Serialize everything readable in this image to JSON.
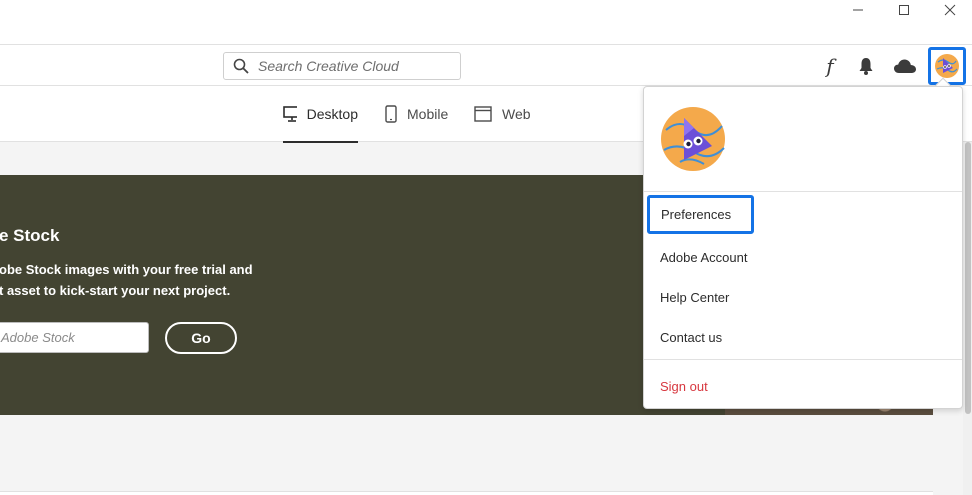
{
  "window": {
    "controls": [
      "minimize-icon",
      "maximize-icon",
      "close-icon"
    ]
  },
  "header": {
    "search_placeholder": "Search Creative Cloud",
    "icons": [
      "search-icon",
      "fonts-icon",
      "bell-icon",
      "cloud-icon",
      "avatar"
    ]
  },
  "tabs": [
    {
      "label": "Desktop",
      "icon": "desktop-icon",
      "active": true
    },
    {
      "label": "Mobile",
      "icon": "mobile-icon",
      "active": false
    },
    {
      "label": "Web",
      "icon": "web-icon",
      "active": false
    }
  ],
  "banner": {
    "title": "e Stock",
    "desc_line1": "obe Stock images with your free trial and",
    "desc_line2": "t asset to kick-start your next project.",
    "input_text": "Adobe Stock",
    "go_label": "Go",
    "background": "#434432"
  },
  "menu": {
    "items": [
      {
        "label": "Preferences",
        "highlighted": true
      },
      {
        "label": "Adobe Account"
      },
      {
        "label": "Help Center"
      },
      {
        "label": "Contact us"
      }
    ],
    "sign_out": "Sign out",
    "sign_out_color": "#d7373f",
    "accent": "#1473e6"
  }
}
